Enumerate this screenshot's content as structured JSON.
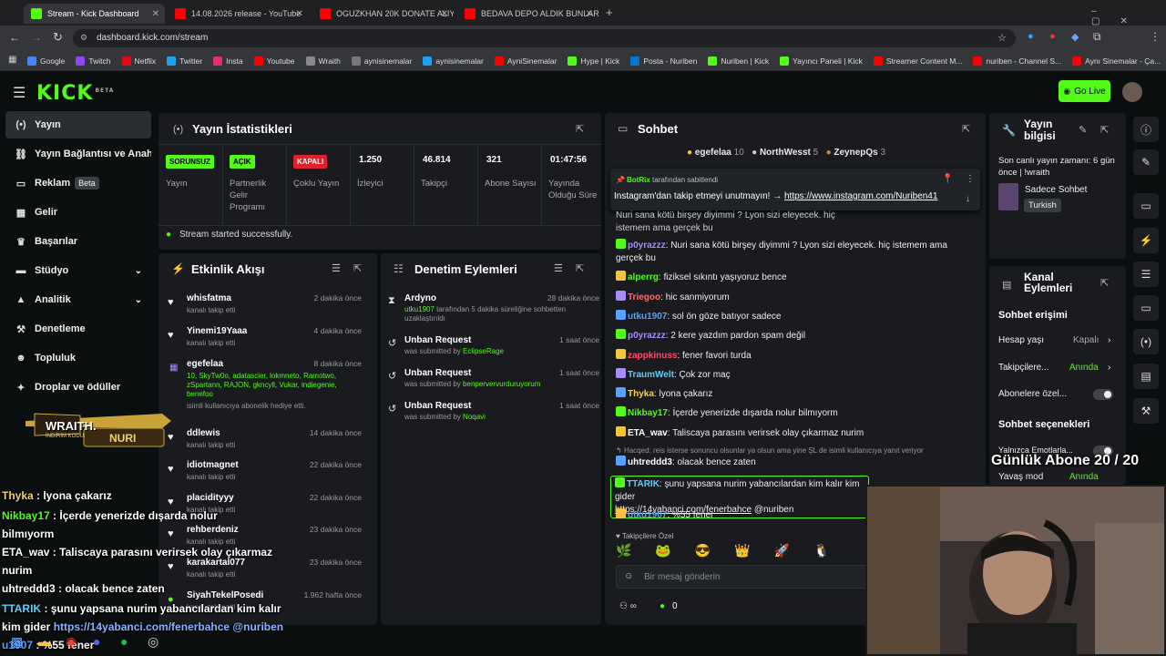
{
  "browser": {
    "tabs": [
      {
        "title": "Stream - Kick Dashboard",
        "active": true
      },
      {
        "title": "14.08.2026 release - YouTube"
      },
      {
        "title": "OGUZKHAN 20K DONATE ALIYO"
      },
      {
        "title": "BEDAVA DEPO ALDIK BUNLAR"
      }
    ],
    "url": "dashboard.kick.com/stream",
    "bookmarks": [
      "Google",
      "Twitch",
      "Netflix",
      "Twitter",
      "Insta",
      "Youtube",
      "Wraith",
      "aynisinemalar",
      "aynisinemalar",
      "AyniSinemalar",
      "Hype | Kick",
      "Posta - Nuriben",
      "Nuriben | Kick",
      "Yayıncı Paneli | Kick",
      "Streamer Content M...",
      "nuriben - Channel S...",
      "Aynı Sinemalar - Ça..."
    ]
  },
  "header": {
    "logo": "KICK",
    "logo_sup": "BETA",
    "go_live": "Go Live"
  },
  "sidebar": {
    "items": [
      {
        "label": "Yayın",
        "icon": "broadcast-icon"
      },
      {
        "label": "Yayın Bağlantısı ve Anahtarı",
        "icon": "link-icon"
      },
      {
        "label": "Reklam",
        "badge": "Beta",
        "icon": "ad-icon"
      },
      {
        "label": "Gelir",
        "icon": "money-icon"
      },
      {
        "label": "Başarılar",
        "icon": "trophy-icon"
      },
      {
        "label": "Stüdyo",
        "icon": "studio-icon"
      },
      {
        "label": "Analitik",
        "icon": "chart-icon"
      },
      {
        "label": "Denetleme",
        "icon": "hammer-icon"
      },
      {
        "label": "Topluluk",
        "icon": "community-icon"
      },
      {
        "label": "Droplar ve ödüller",
        "icon": "gift-icon"
      }
    ]
  },
  "stats": {
    "title": "Yayın İstatistikleri",
    "cols": [
      {
        "tag": "SORUNSUZ",
        "label": "Yayın"
      },
      {
        "tag": "AÇIK",
        "label": "Partnerlik Gelir Programı"
      },
      {
        "tag": "KAPALI",
        "label": "Çoklu Yayın"
      },
      {
        "value": "1.250",
        "label": "İzleyici"
      },
      {
        "value": "46.814",
        "label": "Takipçi"
      },
      {
        "value": "321",
        "label": "Abone Sayısı"
      },
      {
        "value": "01:47:56",
        "label": "Yayında Olduğu Süre"
      }
    ],
    "success": "Stream started successfully."
  },
  "activity": {
    "title": "Etkinlik Akışı",
    "items": [
      {
        "name": "whisfatma",
        "sub": "kanalı takip etti",
        "time": "2 dakika önce"
      },
      {
        "name": "Yinemi19Yaaa",
        "sub": "kanalı takip etti",
        "time": "4 dakika önce"
      },
      {
        "name": "egefelaa",
        "sub_green": "10, SkyTw0o, adatascier, lokmneto, Ramotwo, zSpartann, RAJON, gkncyll, Vukar, indiegenie, benefoo",
        "sub": "isimli kullanıcıya abonelik hediye etti.",
        "time": "8 dakika önce"
      },
      {
        "name": "ddlewis",
        "sub": "kanalı takip etti",
        "time": "14 dakika önce"
      },
      {
        "name": "idiotmagnet",
        "sub": "kanalı takip etti",
        "time": "22 dakika önce"
      },
      {
        "name": "placidityyy",
        "sub": "kanalı takip etti",
        "time": "22 dakika önce"
      },
      {
        "name": "rehberdeniz",
        "sub": "kanalı takip etti",
        "time": "23 dakika önce"
      },
      {
        "name": "karakartal077",
        "sub": "kanalı takip etti",
        "time": "23 dakika önce"
      },
      {
        "name": "SiyahTekelPosedi",
        "sub": "kanalı takip etti",
        "time": "1.962 hafta önce"
      }
    ]
  },
  "moderation": {
    "title": "Denetim Eylemleri",
    "items": [
      {
        "name": "Ardyno",
        "user": "utku1907",
        "sub": "tarafından 5 dakika süreliğine sohbetten uzaklaştırıldı",
        "time": "28 dakika önce"
      },
      {
        "name": "Unban Request",
        "sub": "was submitted by",
        "user": "EclipseRage",
        "time": "1 saat önce"
      },
      {
        "name": "Unban Request",
        "sub": "was submitted by",
        "user": "benpervervurduruyorum",
        "time": "1 saat önce"
      },
      {
        "name": "Unban Request",
        "sub": "was submitted by",
        "user": "Noqavi",
        "time": "1 saat önce"
      }
    ]
  },
  "chat": {
    "title": "Sohbet",
    "top_gifters": [
      {
        "name": "egefelaa",
        "count": "10"
      },
      {
        "name": "NorthWesst",
        "count": "5"
      },
      {
        "name": "ZeynepQs",
        "count": "3"
      }
    ],
    "pinned": {
      "by": "BotRix",
      "by_suffix": "tarafından sabitlendi",
      "text": "Instagram'dan takip etmeyi unutmayın! →",
      "link": "https://www.instagram.com/Nuriben41"
    },
    "messages": [
      {
        "user": "",
        "text": "Nuri sana kötü birşey diyimmi ? Lyon sizi eleyecek. hiç istemem ama gerçek bu",
        "color": "#a78bfa"
      },
      {
        "user": "p0yrazzz",
        "text": "Nuri sana kötü birşey diyimmi ? Lyon sizi eleyecek. hiç istemem ama gerçek bu",
        "color": "#a78bfa"
      },
      {
        "user": "alperrg",
        "text": "fiziksel sıkıntı yaşıyoruz bence",
        "color": "#53fc18"
      },
      {
        "user": "Triegoo",
        "text": "hic sanmiyorum",
        "color": "#ff6b6b"
      },
      {
        "user": "utku1907",
        "text": "sol ön göze batıyor sadece",
        "color": "#5aa0ff"
      },
      {
        "user": "p0yrazzz",
        "text": "2 kere yazdım pardon spam değil",
        "color": "#a78bfa"
      },
      {
        "user": "zappkinuss",
        "text": "fener favori turda",
        "color": "#ff4d6d"
      },
      {
        "user": "TraumWelt",
        "text": "Çok zor maç",
        "color": "#5ad1ff"
      },
      {
        "user": "Thyka",
        "text": "lyona çakarız",
        "color": "#f5d35a"
      },
      {
        "user": "Nikbay17",
        "text": "İçerde yenerizde dışarda nolur bilmıyorm",
        "color": "#53fc18"
      },
      {
        "user": "ETA_wav",
        "text": "Taliscaya parasını verirsek olay çıkarmaz nurim",
        "color": "#ffffff"
      },
      {
        "reply": "Hacqed: reis isterse sonuncu olsunlar ya olsun ama yine ŞL de isimli kullanıcıya yanıt veriyor"
      },
      {
        "user": "uhtreddd3",
        "text": "olacak bence zaten",
        "color": "#ffffff"
      },
      {
        "user": "TTARIK",
        "text": "şunu yapsana nurim yabancılardan kim kalır kim gider",
        "link": "https://14yabanci.com/fenerbahce",
        "mention": "@nuriben",
        "color": "#5ad1ff"
      },
      {
        "user": "utku1907",
        "text": "%55 fener",
        "color": "#5aa0ff"
      }
    ],
    "followers_only": "Takipçilere Özel",
    "input_placeholder": "Bir mesaj gönderin",
    "points": "0"
  },
  "stream_info": {
    "title": "Yayın bilgisi",
    "last_stream": "Son canlı yayın zamanı: 6 gün önce | !wraith",
    "category": "Sadece Sohbet",
    "language": "Turkish"
  },
  "channel_actions": {
    "title": "Kanal Eylemleri",
    "chat_access": "Sohbet erişimi",
    "rows": [
      {
        "label": "Hesap yaşı",
        "value": "Kapalı"
      },
      {
        "label": "Takipçilere...",
        "value": "Anında"
      },
      {
        "label": "Abonelere özel..."
      }
    ],
    "chat_options": "Sohbet seçenekleri",
    "rows2": [
      {
        "label": "Yalnızca Emotlarla..."
      },
      {
        "label": "Yavaş mod",
        "value": "Anında"
      }
    ]
  },
  "overlay": {
    "sponsor_brand": "WRAITH.",
    "sponsor_code_label": "İNDİRİM KODU:",
    "sponsor_code": "NURI",
    "sub_goal": "Günlük Abone 20 / 20",
    "chat": [
      {
        "user": "Thyka",
        "text": " : lyona çakarız",
        "color": "#f5d35a"
      },
      {
        "user": "Nikbay17",
        "text": " : İçerde yenerizde dışarda nolur bilmıyorm",
        "color": "#53fc18"
      },
      {
        "user": "ETA_wav",
        "text": " : Taliscaya parasını verirsek olay çıkarmaz nurim",
        "color": "#ffffff"
      },
      {
        "user": "uhtreddd3",
        "text": " : olacak bence zaten",
        "color": "#ffffff"
      },
      {
        "user": "TTARIK",
        "text": " : şunu yapsana nurim yabancılardan kim kalır kim gider ",
        "link": "https://14yabanci.com/fenerbahce @nuriben",
        "color": "#5ad1ff"
      },
      {
        "user": "u1907",
        "text": " : %55 fener",
        "color": "#5aa0ff"
      }
    ]
  }
}
